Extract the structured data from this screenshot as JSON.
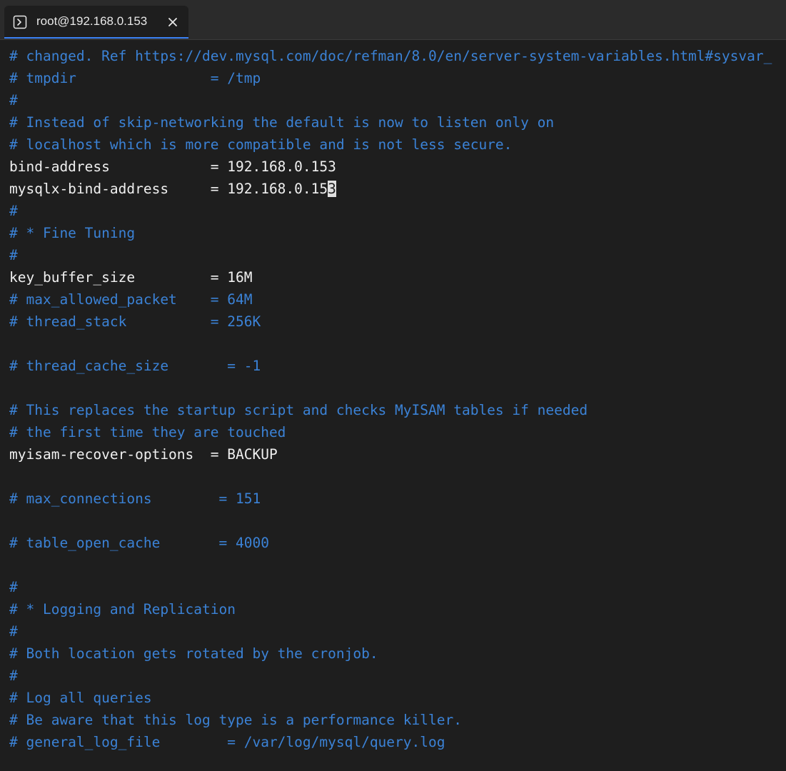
{
  "tab": {
    "title": "root@192.168.0.153",
    "icon": "terminal-icon",
    "close_icon": "close-icon"
  },
  "colors": {
    "comment": "#3b82d6",
    "config": "#f0f0f0",
    "background": "#1e1e1e",
    "tab_accent": "#3b82f6"
  },
  "lines": [
    {
      "text": "# changed. Ref https://dev.mysql.com/doc/refman/8.0/en/server-system-variables.html#sysvar_",
      "type": "comment"
    },
    {
      "text": "# tmpdir                = /tmp",
      "type": "comment"
    },
    {
      "text": "#",
      "type": "comment"
    },
    {
      "text": "# Instead of skip-networking the default is now to listen only on",
      "type": "comment"
    },
    {
      "text": "# localhost which is more compatible and is not less secure.",
      "type": "comment"
    },
    {
      "text": "bind-address            = 192.168.0.153",
      "type": "config"
    },
    {
      "text": "mysqlx-bind-address     = 192.168.0.15",
      "type": "config",
      "cursor_char": "3"
    },
    {
      "text": "#",
      "type": "comment"
    },
    {
      "text": "# * Fine Tuning",
      "type": "comment"
    },
    {
      "text": "#",
      "type": "comment"
    },
    {
      "text": "key_buffer_size         = 16M",
      "type": "config"
    },
    {
      "text": "# max_allowed_packet    = 64M",
      "type": "comment"
    },
    {
      "text": "# thread_stack          = 256K",
      "type": "comment"
    },
    {
      "text": "",
      "type": "blank"
    },
    {
      "text": "# thread_cache_size       = -1",
      "type": "comment"
    },
    {
      "text": "",
      "type": "blank"
    },
    {
      "text": "# This replaces the startup script and checks MyISAM tables if needed",
      "type": "comment"
    },
    {
      "text": "# the first time they are touched",
      "type": "comment"
    },
    {
      "text": "myisam-recover-options  = BACKUP",
      "type": "config"
    },
    {
      "text": "",
      "type": "blank"
    },
    {
      "text": "# max_connections        = 151",
      "type": "comment"
    },
    {
      "text": "",
      "type": "blank"
    },
    {
      "text": "# table_open_cache       = 4000",
      "type": "comment"
    },
    {
      "text": "",
      "type": "blank"
    },
    {
      "text": "#",
      "type": "comment"
    },
    {
      "text": "# * Logging and Replication",
      "type": "comment"
    },
    {
      "text": "#",
      "type": "comment"
    },
    {
      "text": "# Both location gets rotated by the cronjob.",
      "type": "comment"
    },
    {
      "text": "#",
      "type": "comment"
    },
    {
      "text": "# Log all queries",
      "type": "comment"
    },
    {
      "text": "# Be aware that this log type is a performance killer.",
      "type": "comment"
    },
    {
      "text": "# general_log_file        = /var/log/mysql/query.log",
      "type": "comment"
    }
  ]
}
